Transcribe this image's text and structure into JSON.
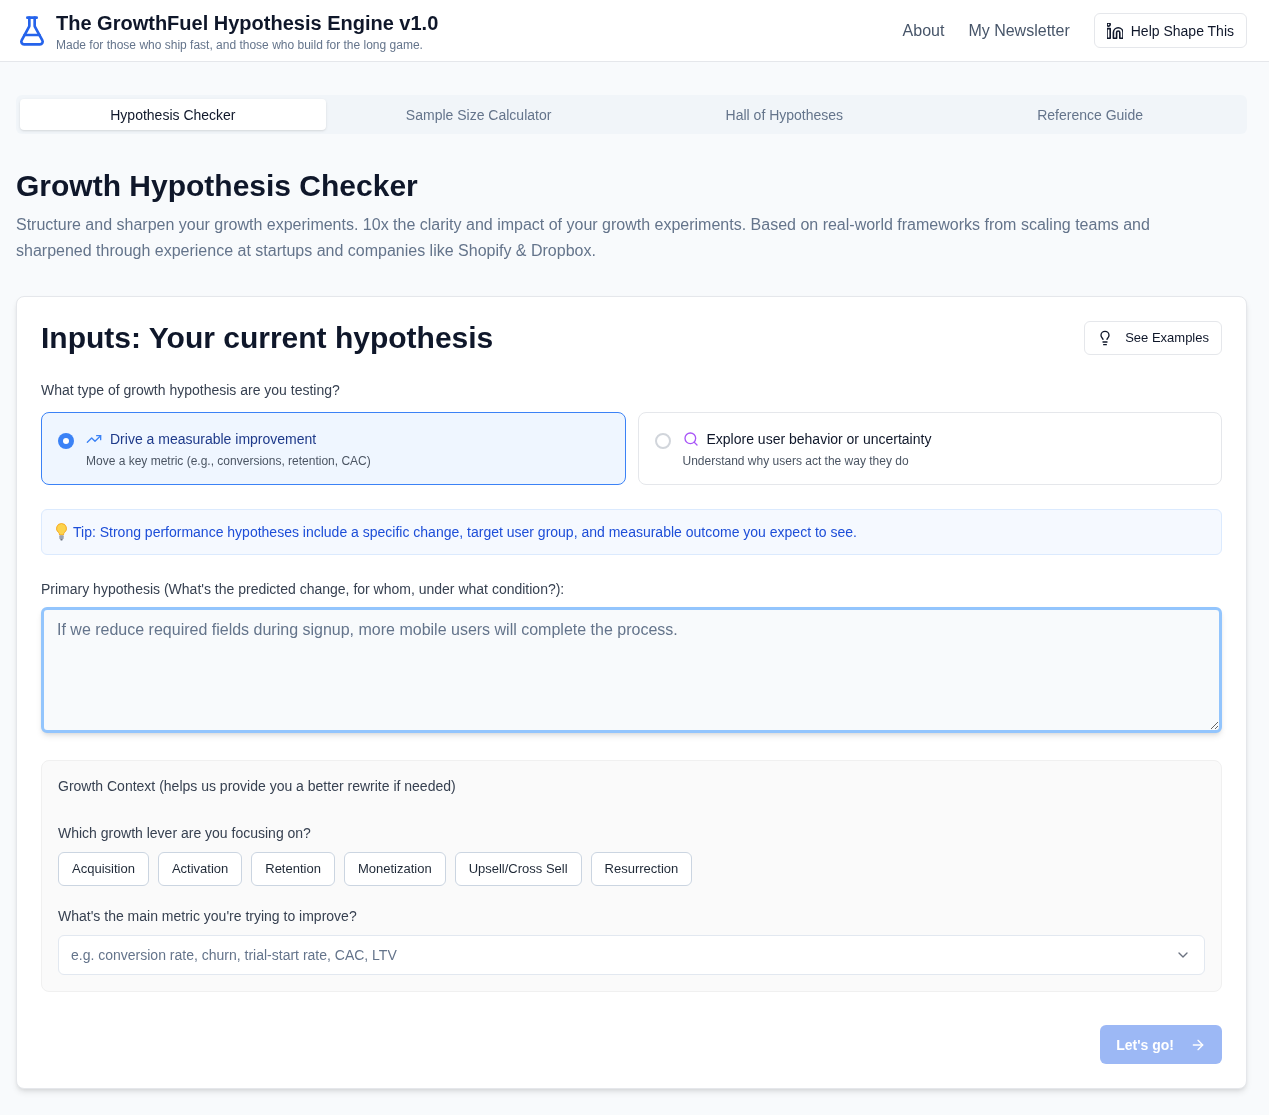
{
  "header": {
    "title": "The GrowthFuel Hypothesis Engine v1.0",
    "subtitle": "Made for those who ship fast, and those who build for the long game.",
    "nav_links": [
      "About",
      "My Newsletter"
    ],
    "cta_button": "Help Shape This"
  },
  "tabs": [
    {
      "label": "Hypothesis Checker",
      "selected": true
    },
    {
      "label": "Sample Size Calculator",
      "selected": false
    },
    {
      "label": "Hall of Hypotheses",
      "selected": false
    },
    {
      "label": "Reference Guide",
      "selected": false
    }
  ],
  "page": {
    "title": "Growth Hypothesis Checker",
    "description": "Structure and sharpen your growth experiments. 10x the clarity and impact of your growth experiments. Based on real-world frameworks from scaling teams and sharpened through experience at startups and companies like Shopify & Dropbox."
  },
  "card": {
    "title": "Inputs: Your current hypothesis",
    "examples_button": "See Examples",
    "type_question": "What type of growth hypothesis are you testing?",
    "hypothesis_types": [
      {
        "kind": "improve",
        "title": "Drive a measurable improvement",
        "description": "Move a key metric (e.g., conversions, retention, CAC)",
        "selected": true
      },
      {
        "kind": "explore",
        "title": "Explore user behavior or uncertainty",
        "description": "Understand why users act the way they do",
        "selected": false
      }
    ],
    "tip": "Tip: Strong performance hypotheses include a specific change, target user group, and measurable outcome you expect to see.",
    "hypothesis_field": {
      "label": "Primary hypothesis (What's the predicted change, for whom, under what condition?):",
      "placeholder": "If we reduce required fields during signup, more mobile users will complete the process.",
      "focused": true
    },
    "context": {
      "title": "Growth Context (helps us provide you a better rewrite if needed)",
      "lever_question": "Which growth lever are you focusing on?",
      "levers": [
        {
          "label": "Acquisition",
          "selected": false
        },
        {
          "label": "Activation",
          "selected": false
        },
        {
          "label": "Retention",
          "selected": false
        },
        {
          "label": "Monetization",
          "selected": false
        },
        {
          "label": "Upsell/Cross Sell",
          "selected": false
        },
        {
          "label": "Resurrection",
          "selected": false
        }
      ],
      "metric_question": "What's the main metric you're trying to improve?",
      "metric_field": {
        "placeholder": "e.g. conversion rate, churn, trial-start rate, CAC, LTV"
      }
    },
    "submit_button": {
      "label": "Let's go!",
      "disabled": true
    }
  }
}
